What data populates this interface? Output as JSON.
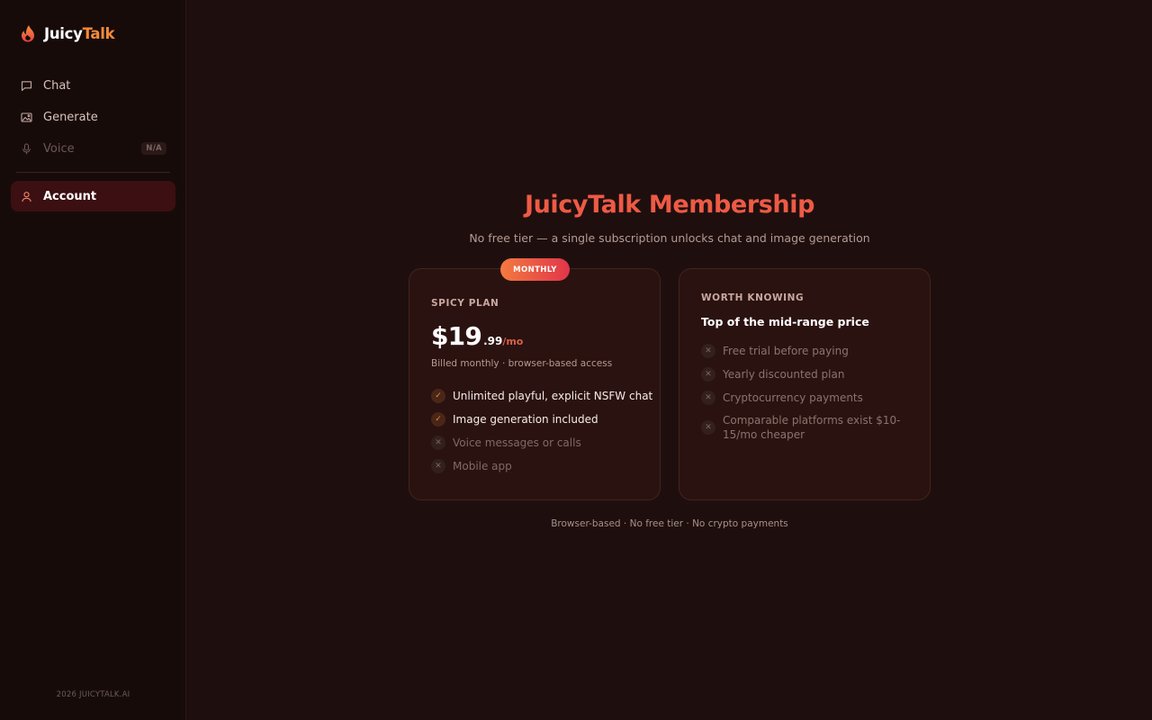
{
  "app": {
    "logo_part1": "Juicy",
    "logo_part2": "Talk",
    "brand_color": "#f58a3a",
    "accent_color": "#ee5a45"
  },
  "sidebar": {
    "items": [
      {
        "label": "Chat",
        "icon": "chat-bubble-icon"
      },
      {
        "label": "Generate",
        "icon": "image-icon"
      },
      {
        "label": "Voice",
        "icon": "microphone-icon",
        "badge": "N/A",
        "disabled": true
      }
    ],
    "account": {
      "label": "Account",
      "icon": "user-icon",
      "active": true
    },
    "copyright": "2026 JUICYTALK.AI"
  },
  "main": {
    "title": "JuicyTalk Membership",
    "subtitle": "No free tier — a single subscription unlocks chat and image generation",
    "plan_card": {
      "ribbon": "MONTHLY",
      "label": "SPICY PLAN",
      "price_whole": "$19",
      "price_cents": ".99",
      "price_period": "/mo",
      "billing": "Billed monthly · browser-based access",
      "features": [
        {
          "text": "Unlimited playful, explicit NSFW chat",
          "included": true
        },
        {
          "text": "Image generation included",
          "included": true
        },
        {
          "text": "Voice messages or calls",
          "included": false
        },
        {
          "text": "Mobile app",
          "included": false
        }
      ]
    },
    "info_card": {
      "label": "WORTH KNOWING",
      "headline": "Top of the mid-range price",
      "items": [
        "Free trial before paying",
        "Yearly discounted plan",
        "Cryptocurrency payments",
        "Comparable platforms exist $10-15/mo cheaper"
      ]
    },
    "footnote": "Browser-based · No free tier · No crypto payments"
  }
}
